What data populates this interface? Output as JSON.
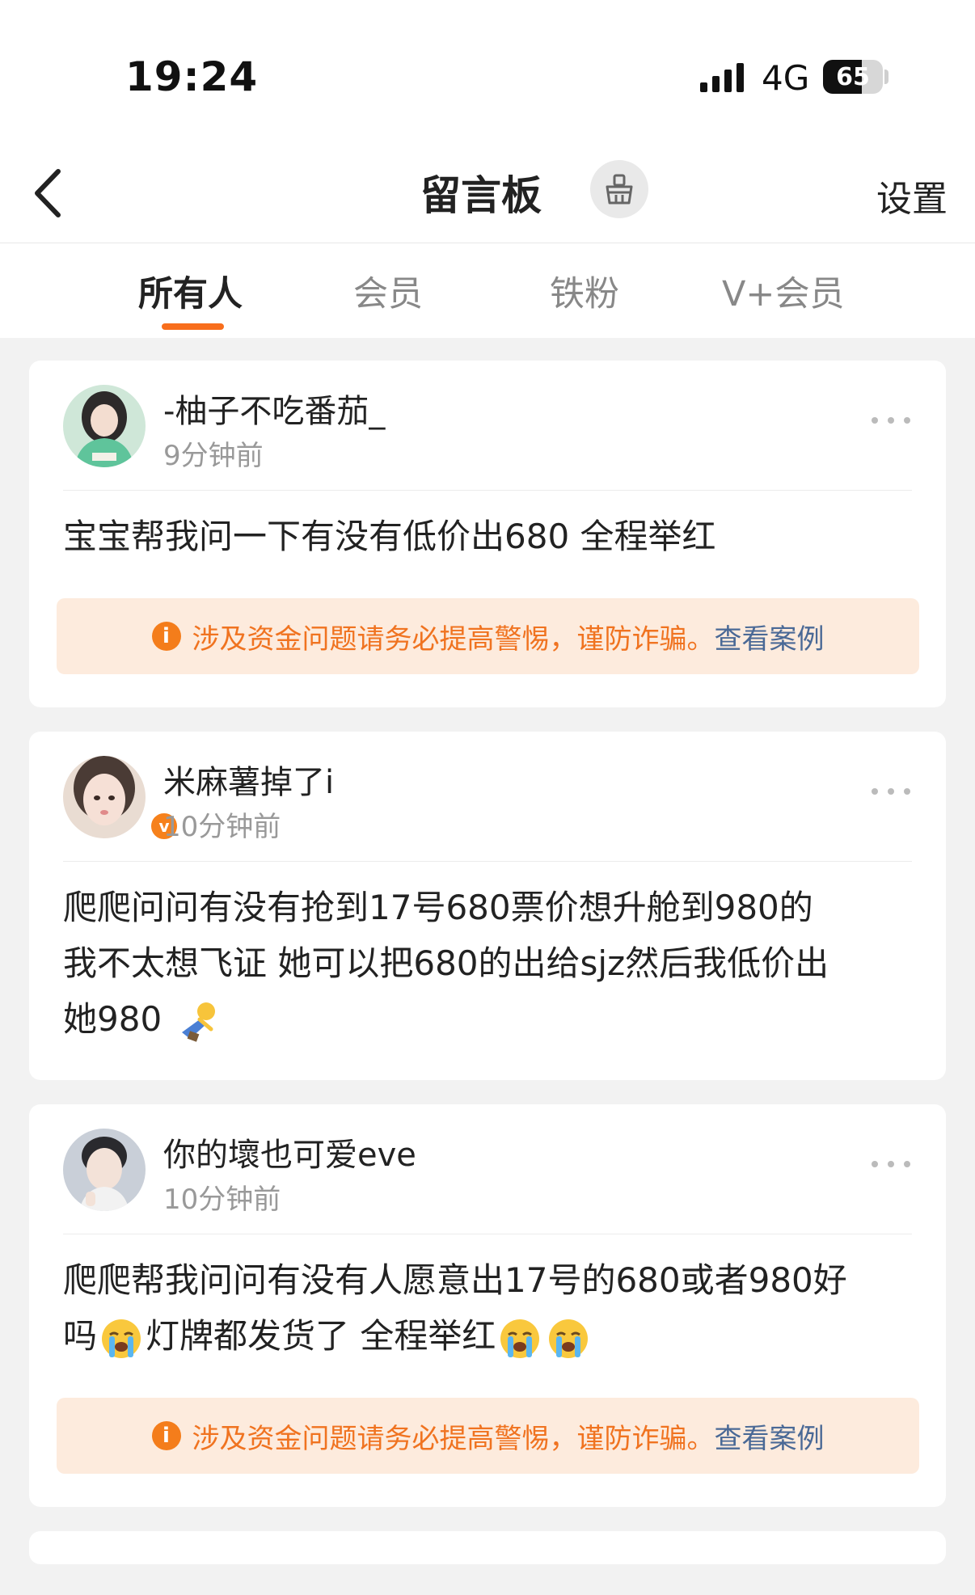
{
  "status_bar": {
    "time": "19:24",
    "network": "4G",
    "battery": "65"
  },
  "nav": {
    "title": "留言板",
    "settings_label": "设置"
  },
  "tabs": [
    {
      "label": "所有人",
      "active": true
    },
    {
      "label": "会员",
      "active": false
    },
    {
      "label": "铁粉",
      "active": false
    },
    {
      "label": "V+会员",
      "active": false
    }
  ],
  "warning": {
    "text": "涉及资金问题请务必提高警惕，谨防诈骗。",
    "link": "查看案例"
  },
  "posts": [
    {
      "username": "-柚子不吃番茄_",
      "time": "9分钟前",
      "text": "宝宝帮我问一下有没有低价出680 全程举红",
      "verified": false,
      "has_warning": true
    },
    {
      "username": "米麻薯掉了i",
      "time": "10分钟前",
      "text_lines": [
        "爬爬问问有没有抢到17号680票价想升舱到980的",
        "我不太想飞证 她可以把680的出给sjz然后我低价出",
        "她980"
      ],
      "verified": true,
      "has_warning": false
    },
    {
      "username": "你的壞也可爱eve",
      "time": "10分钟前",
      "text_parts": [
        "爬爬帮我问问有没有人愿意出17号的680或者980好",
        "吗",
        "灯牌都发货了 全程举红"
      ],
      "verified": false,
      "has_warning": true
    }
  ],
  "colors": {
    "accent": "#f86e1c",
    "warning_bg": "#fdebdd",
    "warning_text": "#f07320",
    "link": "#4a6996"
  }
}
